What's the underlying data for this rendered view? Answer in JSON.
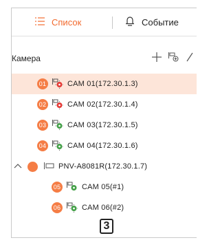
{
  "tabs": {
    "list": {
      "label": "Список",
      "icon": "list-icon"
    },
    "event": {
      "label": "Событие",
      "icon": "bell-icon"
    }
  },
  "section": {
    "title": "Камера",
    "tools": [
      "add-icon",
      "add-camera-icon",
      "edit-icon"
    ]
  },
  "rows": [
    {
      "badge": "01",
      "label": "CAM 01(172.30.1.3)",
      "selected": true
    },
    {
      "badge": "02",
      "label": "CAM 02(172.30.1.4)"
    },
    {
      "badge": "03",
      "label": "CAM 03(172.30.1.5)"
    },
    {
      "badge": "04",
      "label": "CAM 04(172.30.1.6)"
    }
  ],
  "nvr": {
    "label": "PNV-A8081R(172.30.1.7)",
    "expanded": true
  },
  "children": [
    {
      "badge": "05",
      "label": "CAM 05(#1)"
    },
    {
      "badge": "06",
      "label": "CAM 06(#2)"
    }
  ],
  "callout": "3",
  "colors": {
    "accent": "#f26a2e",
    "badge": "#f57d45",
    "selected_bg": "#fde5d9"
  }
}
